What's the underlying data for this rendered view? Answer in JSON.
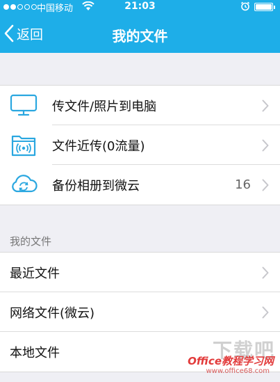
{
  "status_bar": {
    "carrier": "中国移动",
    "time": "21:03",
    "signal_bars": 2,
    "signal_total": 5,
    "battery_level": 1.0
  },
  "nav": {
    "back_label": "返回",
    "title": "我的文件"
  },
  "group_1": [
    {
      "label": "传文件/照片到电脑",
      "icon": "monitor-icon",
      "count": ""
    },
    {
      "label": "文件近传(0流量)",
      "icon": "nearby-transfer-icon",
      "count": ""
    },
    {
      "label": "备份相册到微云",
      "icon": "cloud-sync-icon",
      "count": "16"
    }
  ],
  "section_header": "我的文件",
  "group_2": [
    {
      "label": "最近文件",
      "has_chevron": true
    },
    {
      "label": "网络文件(微云)",
      "has_chevron": true
    },
    {
      "label": "本地文件",
      "has_chevron": false
    }
  ],
  "watermark": {
    "chars": "下载吧",
    "brand": "Office教程学习网",
    "url": "www.office68.com"
  },
  "colors": {
    "accent": "#1eaee8",
    "background": "#efeff4",
    "icon_blue": "#2aa7e0",
    "chevron": "#c7c7cc"
  }
}
